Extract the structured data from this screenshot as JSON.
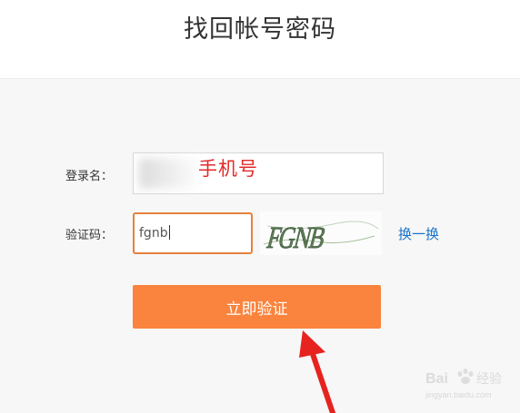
{
  "page": {
    "title": "找回帐号密码"
  },
  "form": {
    "username_label": "登录名：",
    "username_annotation": "手机号",
    "captcha_label": "验证码：",
    "captcha_value": "fgnb",
    "captcha_image_text": "FGNB",
    "refresh_label": "换一换",
    "submit_label": "立即验证"
  },
  "watermark": {
    "brand": "Baidu经验",
    "url": "jingyan.baidu.com"
  },
  "colors": {
    "accent": "#fa833d",
    "input_focus_border": "#e5813e",
    "link": "#1a73c9",
    "annotation": "#e42b2b"
  }
}
